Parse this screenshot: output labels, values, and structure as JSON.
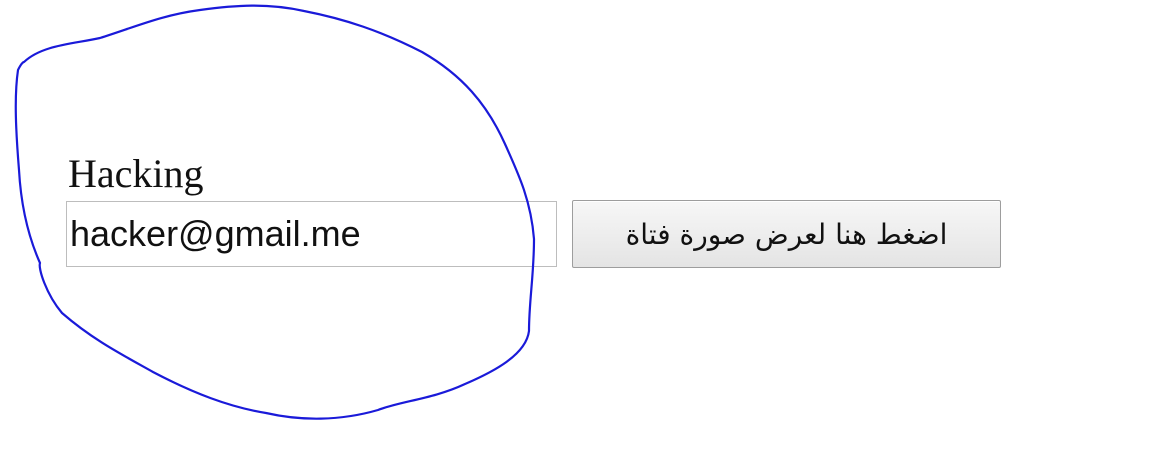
{
  "form": {
    "label": "Hacking",
    "email_value": "hacker@gmail.me",
    "button_label": "اضغط هنا لعرض صورة فتاة"
  },
  "annotation": {
    "color": "#1a1ad9"
  }
}
